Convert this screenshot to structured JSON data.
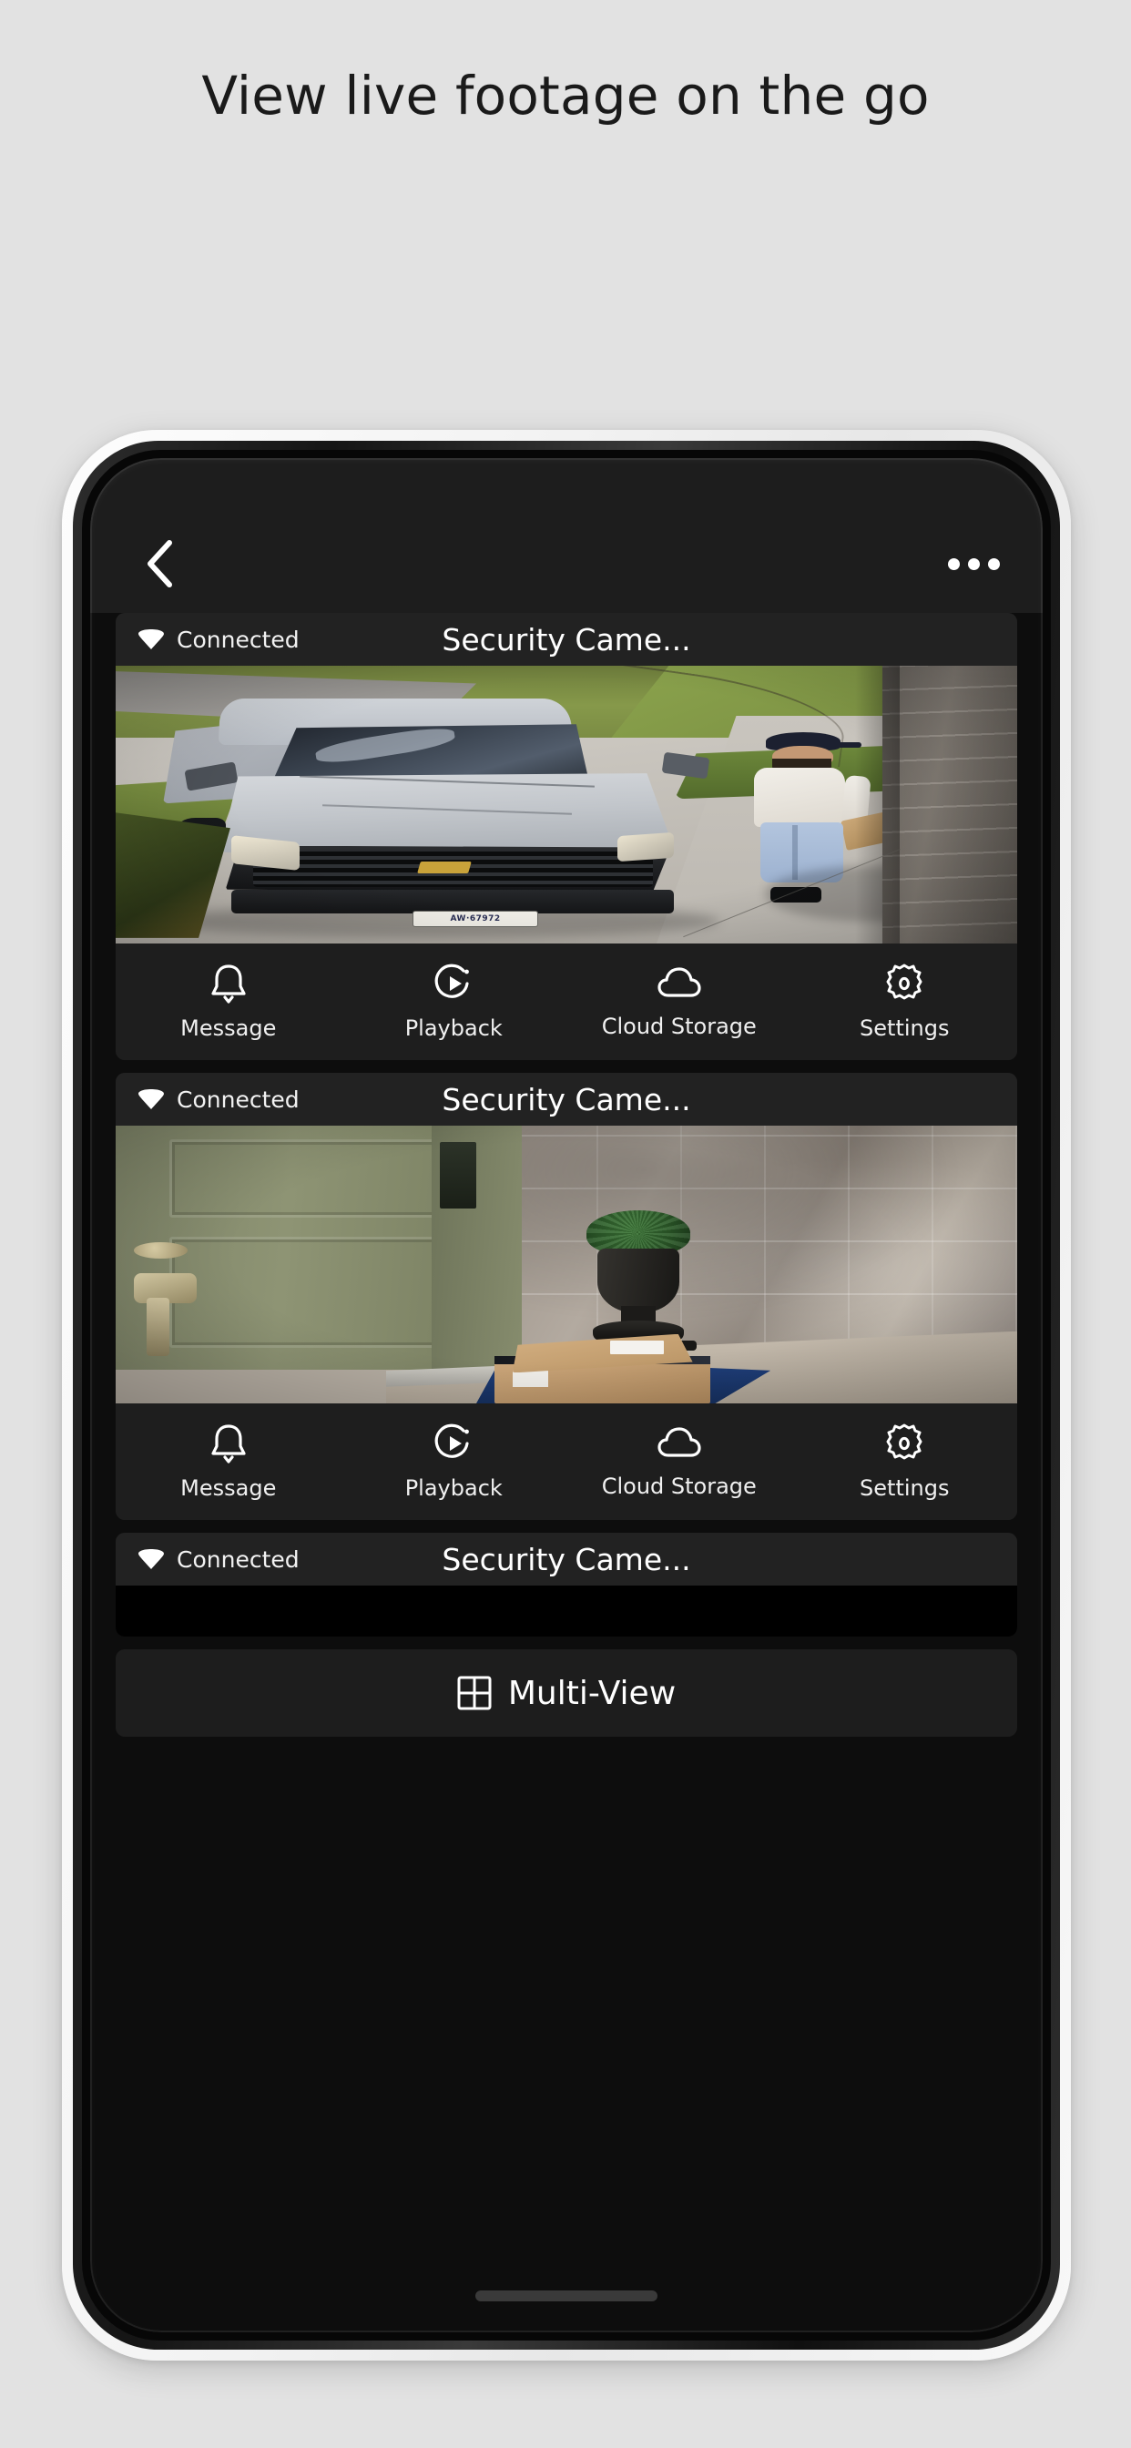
{
  "headline": "View live footage on the go",
  "appbar": {
    "back_icon": "chevron-left-icon",
    "more_icon": "overflow-menu-icon"
  },
  "cameras": [
    {
      "status": "Connected",
      "status_icon": "wifi-icon",
      "title": "Security Came...",
      "scene": "driveway with silver Chevrolet pickup truck and delivery person carrying a package",
      "license_plate": "AW·67972"
    },
    {
      "status": "Connected",
      "status_icon": "wifi-icon",
      "title": "Security Came...",
      "scene": "front porch with green door, stone wall, planter urn and delivered cardboard boxes on blue mat"
    },
    {
      "status": "Connected",
      "status_icon": "wifi-icon",
      "title": "Security Came...",
      "scene": "black / no signal"
    }
  ],
  "toolbar": [
    {
      "label": "Message",
      "icon": "bell-icon"
    },
    {
      "label": "Playback",
      "icon": "play-circle-icon"
    },
    {
      "label": "Cloud Storage",
      "icon": "cloud-icon"
    },
    {
      "label": "Settings",
      "icon": "gear-icon"
    }
  ],
  "multiview": {
    "label": "Multi-View",
    "icon": "grid-2x2-icon"
  },
  "colors": {
    "page_background": "#e2e2e2",
    "screen_background": "#0d0d0d",
    "card_background": "#1d1d1d",
    "card_header": "#222222",
    "toolbar_background": "#1e1e1e",
    "text_primary": "#ffffff"
  }
}
